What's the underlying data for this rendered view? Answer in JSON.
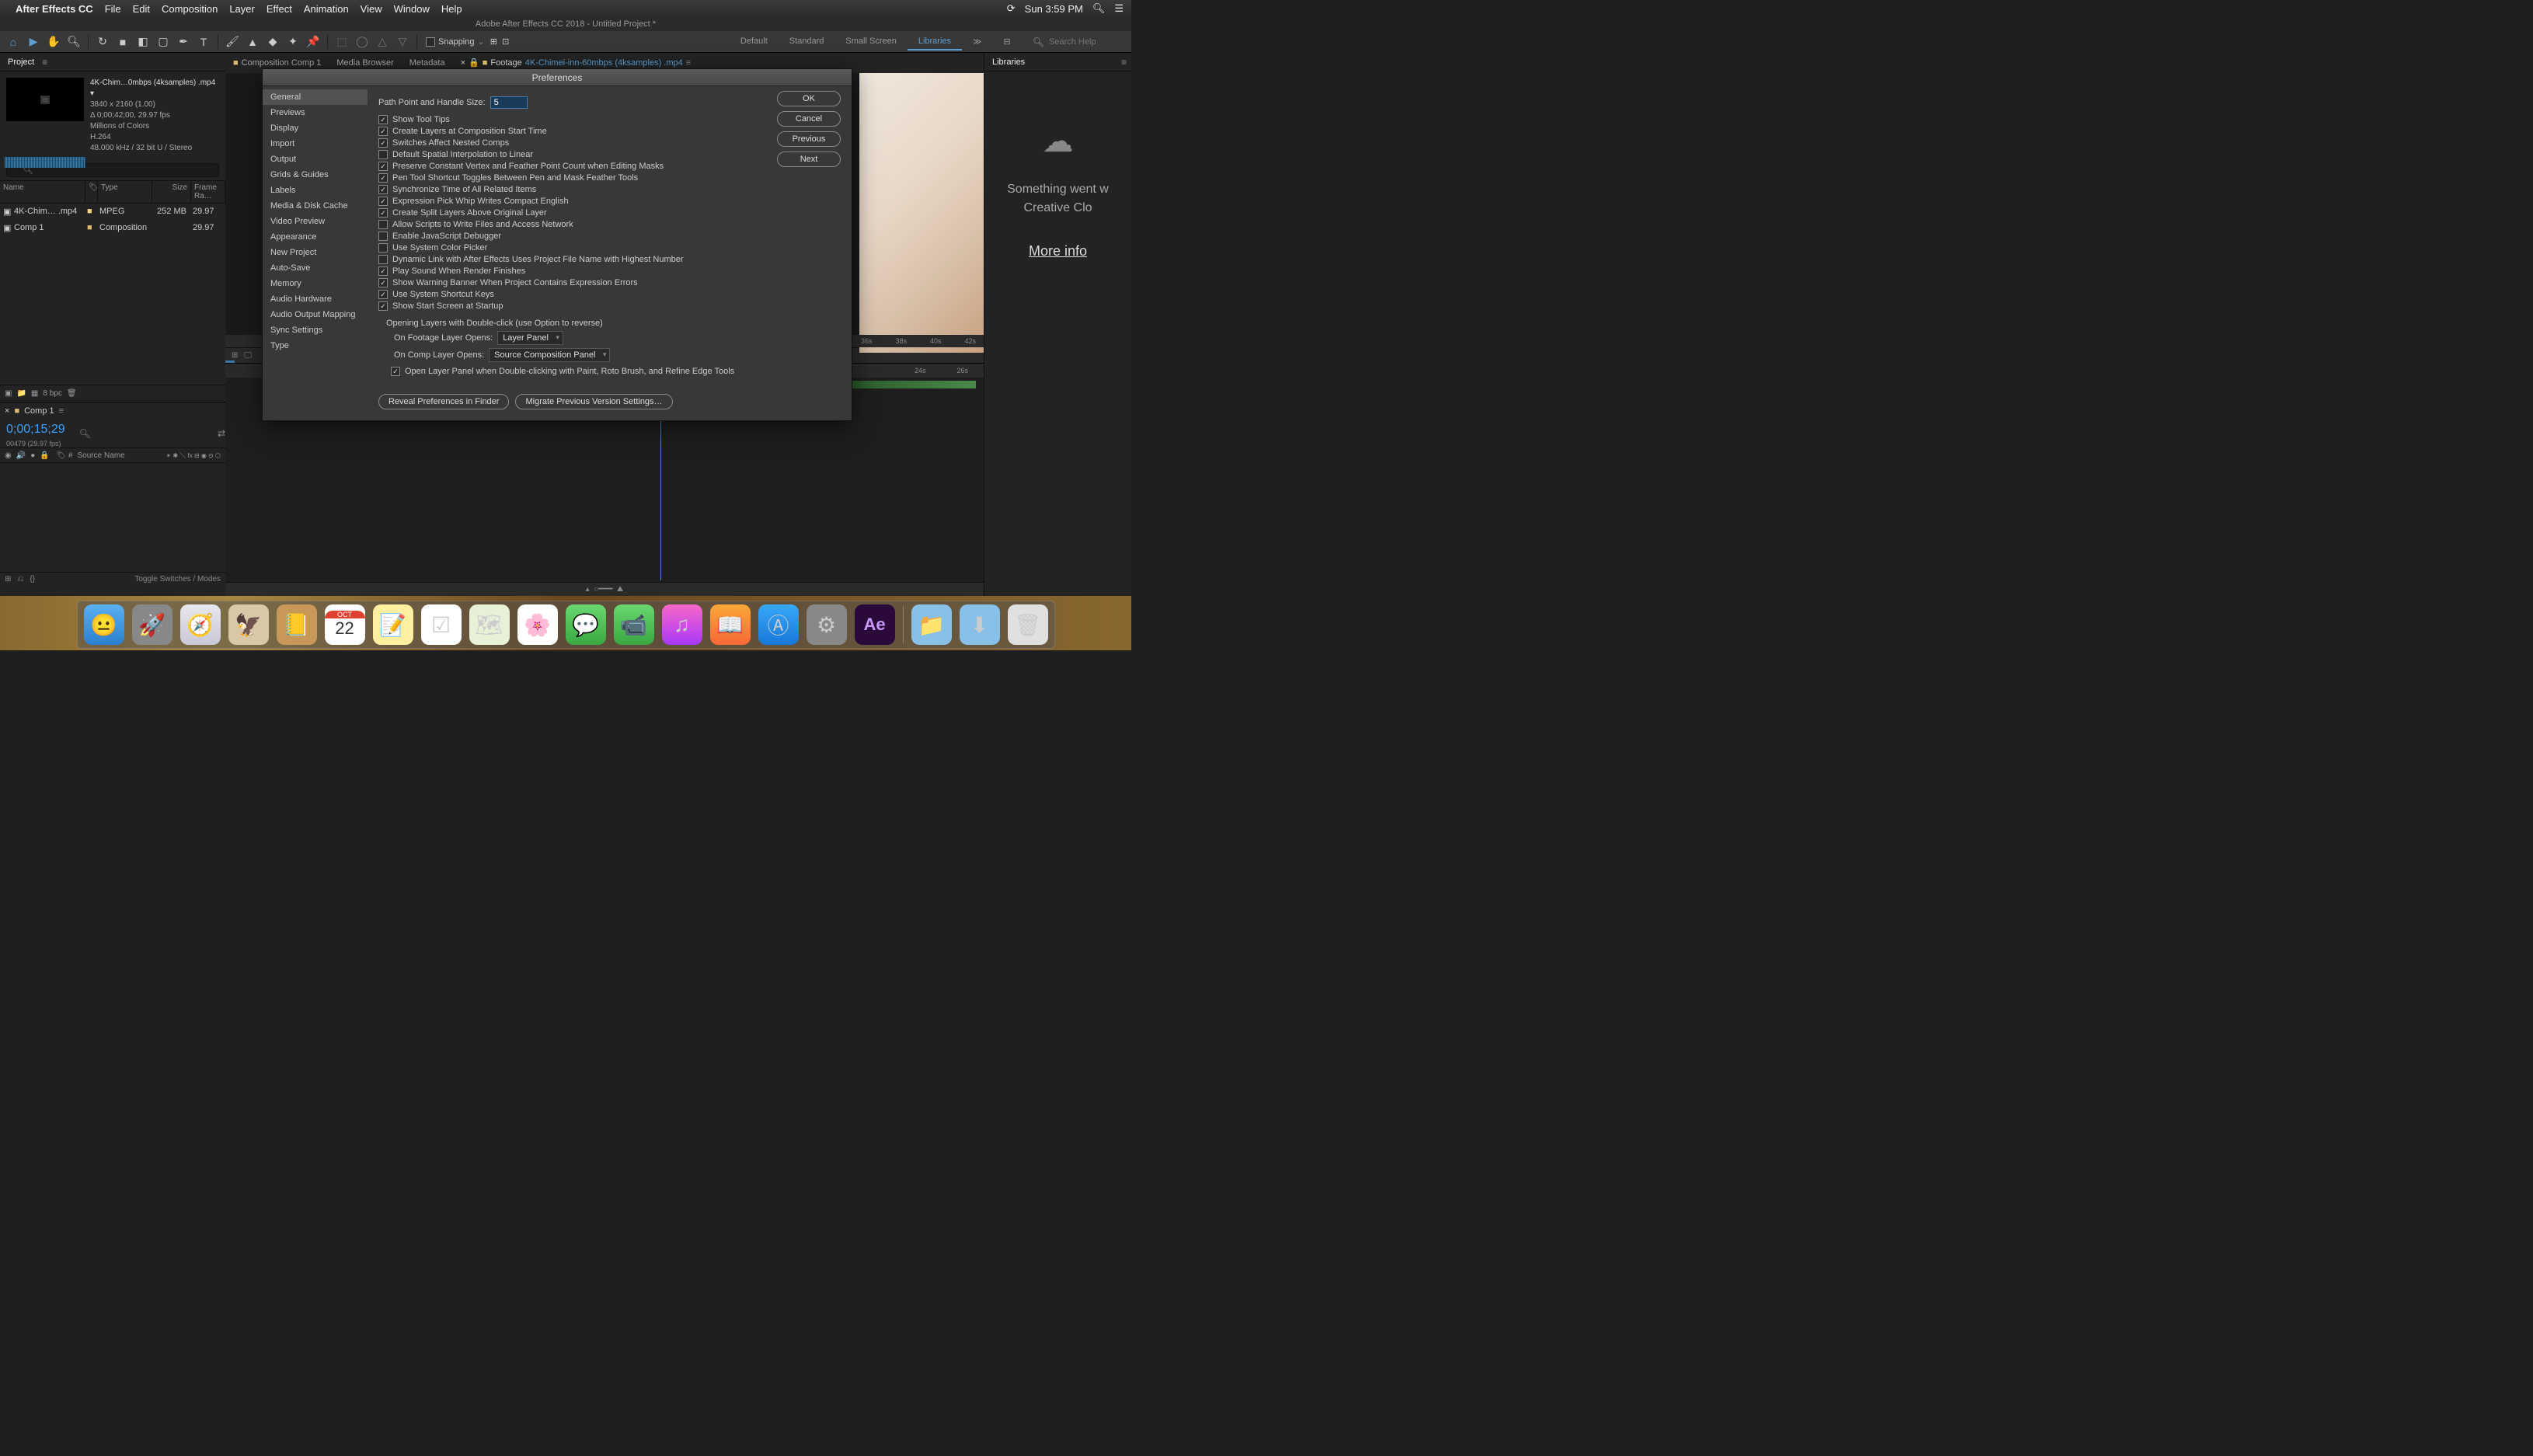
{
  "menubar": {
    "app": "After Effects CC",
    "items": [
      "File",
      "Edit",
      "Composition",
      "Layer",
      "Effect",
      "Animation",
      "View",
      "Window",
      "Help"
    ],
    "clock": "Sun 3:59 PM"
  },
  "titlebar": "Adobe After Effects CC 2018 - Untitled Project *",
  "toolbar": {
    "snapping": "Snapping",
    "workspaces": [
      "Default",
      "Standard",
      "Small Screen",
      "Libraries"
    ],
    "ws_active": 3,
    "search_ph": "Search Help"
  },
  "project": {
    "tab": "Project",
    "file": {
      "name": "4K-Chim…0mbps (4ksamples) .mp4",
      "dims": "3840 x 2160 (1.00)",
      "dur": "Δ 0;00;42;00, 29.97 fps",
      "colors": "Millions of Colors",
      "codec": "H.264",
      "audio": "48.000 kHz / 32 bit U / Stereo"
    },
    "cols": [
      "Name",
      "Type",
      "Size",
      "Frame Ra…"
    ],
    "rows": [
      {
        "name": "4K-Chim… .mp4",
        "type": "MPEG",
        "size": "252 MB",
        "fr": "29.97"
      },
      {
        "name": "Comp 1",
        "type": "Composition",
        "size": "",
        "fr": "29.97"
      }
    ],
    "bpc": "8 bpc"
  },
  "timeline": {
    "tab": "Comp 1",
    "tc": "0;00;15;29",
    "sub": "00479 (29.97 fps)",
    "srcname": "Source Name",
    "toggle": "Toggle Switches / Modes"
  },
  "mid": {
    "tabs": [
      {
        "label": "Composition Comp 1"
      },
      {
        "label": "Media Browser"
      },
      {
        "label": "Metadata"
      },
      {
        "label": "Footage",
        "link": "4K-Chimei-inn-60mbps (4ksamples) .mp4"
      }
    ],
    "ruler": [
      "36s",
      "38s",
      "40s",
      "42s"
    ],
    "ruler2": [
      "24s",
      "26s"
    ]
  },
  "libs": {
    "tab": "Libraries",
    "msg1": "Something went w",
    "msg2": "Creative Clo",
    "link": "More info"
  },
  "prefs": {
    "title": "Preferences",
    "categories": [
      "General",
      "Previews",
      "Display",
      "Import",
      "Output",
      "Grids & Guides",
      "Labels",
      "Media & Disk Cache",
      "Video Preview",
      "Appearance",
      "New Project",
      "Auto-Save",
      "Memory",
      "Audio Hardware",
      "Audio Output Mapping",
      "Sync Settings",
      "Type"
    ],
    "cat_active": 0,
    "btns": {
      "ok": "OK",
      "cancel": "Cancel",
      "prev": "Previous",
      "next": "Next"
    },
    "path_label": "Path Point and Handle Size:",
    "path_val": "5",
    "checks": [
      {
        "on": true,
        "label": "Show Tool Tips"
      },
      {
        "on": true,
        "label": "Create Layers at Composition Start Time"
      },
      {
        "on": true,
        "label": "Switches Affect Nested Comps"
      },
      {
        "on": false,
        "label": "Default Spatial Interpolation to Linear"
      },
      {
        "on": true,
        "label": "Preserve Constant Vertex and Feather Point Count when Editing Masks"
      },
      {
        "on": true,
        "label": "Pen Tool Shortcut Toggles Between Pen and Mask Feather Tools"
      },
      {
        "on": true,
        "label": "Synchronize Time of All Related Items"
      },
      {
        "on": true,
        "label": "Expression Pick Whip Writes Compact English"
      },
      {
        "on": true,
        "label": "Create Split Layers Above Original Layer"
      },
      {
        "on": false,
        "label": "Allow Scripts to Write Files and Access Network"
      },
      {
        "on": false,
        "label": "Enable JavaScript Debugger"
      },
      {
        "on": false,
        "label": "Use System Color Picker"
      },
      {
        "on": false,
        "label": "Dynamic Link with After Effects Uses Project File Name with Highest Number"
      },
      {
        "on": true,
        "label": "Play Sound When Render Finishes"
      },
      {
        "on": true,
        "label": "Show Warning Banner When Project Contains Expression Errors"
      },
      {
        "on": true,
        "label": "Use System Shortcut Keys"
      },
      {
        "on": true,
        "label": "Show Start Screen at Startup"
      }
    ],
    "section": "Opening Layers with Double-click (use Option to reverse)",
    "footage_label": "On Footage Layer Opens:",
    "footage_val": "Layer Panel",
    "comp_label": "On Comp Layer Opens:",
    "comp_val": "Source Composition Panel",
    "open_check": {
      "on": true,
      "label": "Open Layer Panel when Double-clicking with Paint, Roto Brush, and Refine Edge Tools"
    },
    "reveal": "Reveal Preferences in Finder",
    "migrate": "Migrate Previous Version Settings…"
  },
  "dock": [
    "finder",
    "launchpad",
    "safari",
    "mail",
    "contacts",
    "calendar",
    "notes",
    "reminders",
    "maps",
    "photos",
    "messages",
    "facetime",
    "itunes",
    "ibooks",
    "appstore",
    "sysprefs",
    "ae",
    "|",
    "folder1",
    "folder2",
    "trash"
  ],
  "dock_cal": "22",
  "dock_cal_month": "OCT"
}
